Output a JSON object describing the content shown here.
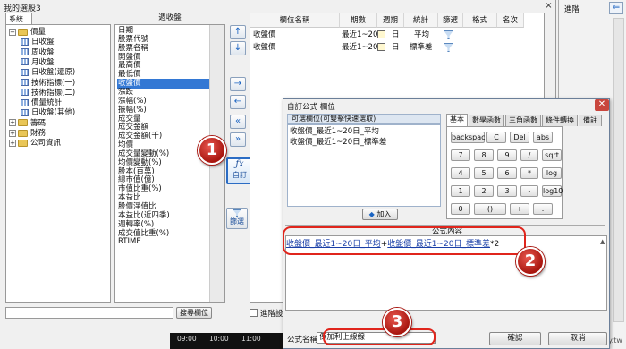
{
  "main_window": {
    "title": "我的選股3",
    "close_glyph": "×",
    "system_tab": "系統",
    "tree": [
      {
        "label": "價量",
        "kind": "folder",
        "toggle": "−",
        "level": 0
      },
      {
        "label": "日收盤",
        "kind": "item",
        "level": 1
      },
      {
        "label": "周收盤",
        "kind": "item",
        "level": 1
      },
      {
        "label": "月收盤",
        "kind": "item",
        "level": 1
      },
      {
        "label": "日收盤(還原)",
        "kind": "item",
        "level": 1
      },
      {
        "label": "技術指標(一)",
        "kind": "item",
        "level": 1
      },
      {
        "label": "技術指標(二)",
        "kind": "item",
        "level": 1
      },
      {
        "label": "價量統計",
        "kind": "item",
        "level": 1
      },
      {
        "label": "日收盤(其他)",
        "kind": "item",
        "level": 1
      },
      {
        "label": "籌碼",
        "kind": "folder",
        "toggle": "+",
        "level": 0
      },
      {
        "label": "財務",
        "kind": "folder",
        "toggle": "+",
        "level": 0
      },
      {
        "label": "公司資訊",
        "kind": "folder",
        "toggle": "+",
        "level": 0
      }
    ],
    "field_list_header": "週收盤",
    "field_list": [
      "日期",
      "股票代號",
      "股票名稱",
      "開盤價",
      "最高價",
      "最低價",
      "收盤價",
      "漲跌",
      "漲幅(%)",
      "振幅(%)",
      "成交量",
      "成交金額",
      "成交金額(千)",
      "均價",
      "成交量變動(%)",
      "均價變動(%)",
      "股本(百萬)",
      "總市值(億)",
      "市值比重(%)",
      "本益比",
      "股價淨值比",
      "本益比(近四季)",
      "週轉率(%)",
      "成交值比重(%)",
      "RTIME"
    ],
    "selected_field": "收盤價",
    "arrow_buttons": {
      "up": "↑",
      "down": "↓",
      "right": "→",
      "left": "←",
      "all_left": "«",
      "all_right": "»"
    },
    "custom_button_label": "自訂",
    "custom_button_icon": "fx-icon",
    "filter_button_label": "篩選",
    "table_headers": [
      "欄位名稱",
      "期數",
      "週期",
      "統計",
      "篩選",
      "格式",
      "名次"
    ],
    "table_rows": [
      {
        "name": "收盤價",
        "period": "最近1~20",
        "cycle": "日",
        "stat": "平均"
      },
      {
        "name": "收盤價",
        "period": "最近1~20",
        "cycle": "日",
        "stat": "標準差"
      }
    ],
    "search_placeholder": "",
    "search_button": "搜尋欄位",
    "advanced_label": "進階設"
  },
  "background": {
    "ticks": [
      "09:00",
      "10:00",
      "11:00"
    ]
  },
  "edge_window": {
    "label": "進階",
    "back_glyph": "⇐"
  },
  "watermark": "cmoney.tw",
  "formula_dialog": {
    "title": "自訂公式 欄位",
    "close_glyph": "✕",
    "available_header": "可選欄位(可雙擊快速選取)",
    "available_items": [
      "收盤價_最近1~20日_平均",
      "收盤價_最近1~20日_標準差"
    ],
    "add_button": "加入",
    "tabs": [
      "基本",
      "數學函數",
      "三角函數",
      "條件轉換",
      "備註"
    ],
    "active_tab": "基本",
    "keypad": [
      [
        "backspace",
        "C",
        "Del",
        "abs"
      ],
      [
        "7",
        "8",
        "9",
        "/",
        "sqrt"
      ],
      [
        "4",
        "5",
        "6",
        "*",
        "log"
      ],
      [
        "1",
        "2",
        "3",
        "-",
        "log10"
      ],
      [
        "0",
        "()",
        "+",
        "."
      ]
    ],
    "content_label": "公式內容",
    "formula": {
      "ref1": "收盤價_最近1~20日_平均",
      "op": "+",
      "ref2": "收盤價_最近1~20日_標準差",
      "tail": "*2"
    },
    "name_label": "公式名稱",
    "name_value": "保加利上線線",
    "ok_button": "確認",
    "cancel_button": "取消"
  },
  "callouts": [
    "1",
    "2",
    "3"
  ],
  "colors": {
    "callout_red": "#c0221a",
    "selection_blue": "#3378d4",
    "link_blue": "#1a3fa8"
  }
}
